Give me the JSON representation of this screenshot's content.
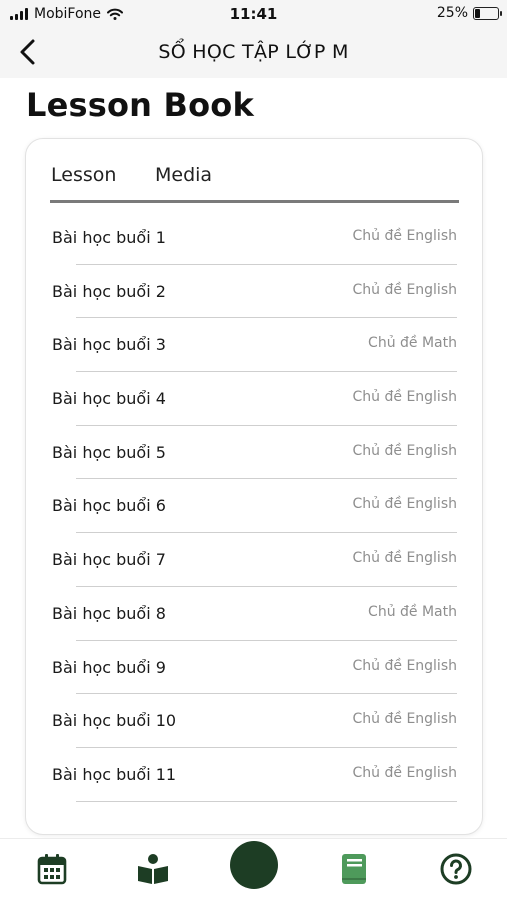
{
  "status_bar": {
    "carrier": "MobiFone",
    "time": "11:41",
    "battery_percent_label": "25%",
    "battery_level": 0.25
  },
  "nav": {
    "title": "SỔ HỌC TẬP LỚP M",
    "back_icon": "chevron-left-icon"
  },
  "page": {
    "title": "Lesson Book"
  },
  "tabs": [
    {
      "label": "Lesson"
    },
    {
      "label": "Media"
    }
  ],
  "lessons": [
    {
      "name": "Bài học buổi 1",
      "topic": "Chủ đề English"
    },
    {
      "name": "Bài học buổi 2",
      "topic": "Chủ đề English"
    },
    {
      "name": "Bài học buổi 3",
      "topic": "Chủ đề Math"
    },
    {
      "name": "Bài học buổi 4",
      "topic": "Chủ đề English"
    },
    {
      "name": "Bài học buổi 5",
      "topic": "Chủ đề English"
    },
    {
      "name": "Bài học buổi 6",
      "topic": "Chủ đề English"
    },
    {
      "name": "Bài học buổi 7",
      "topic": "Chủ đề English"
    },
    {
      "name": "Bài học buổi 8",
      "topic": "Chủ đề Math"
    },
    {
      "name": "Bài học buổi 9",
      "topic": "Chủ đề English"
    },
    {
      "name": "Bài học buổi 10",
      "topic": "Chủ đề English"
    },
    {
      "name": "Bài học buổi 11",
      "topic": "Chủ đề English"
    }
  ],
  "bottom_tabs": {
    "items": [
      "calendar-icon",
      "reading-icon",
      "home-button",
      "lesson-book-icon",
      "help-icon"
    ],
    "colors": {
      "primary": "#1d3d24",
      "active": "#4e9a5b"
    }
  }
}
